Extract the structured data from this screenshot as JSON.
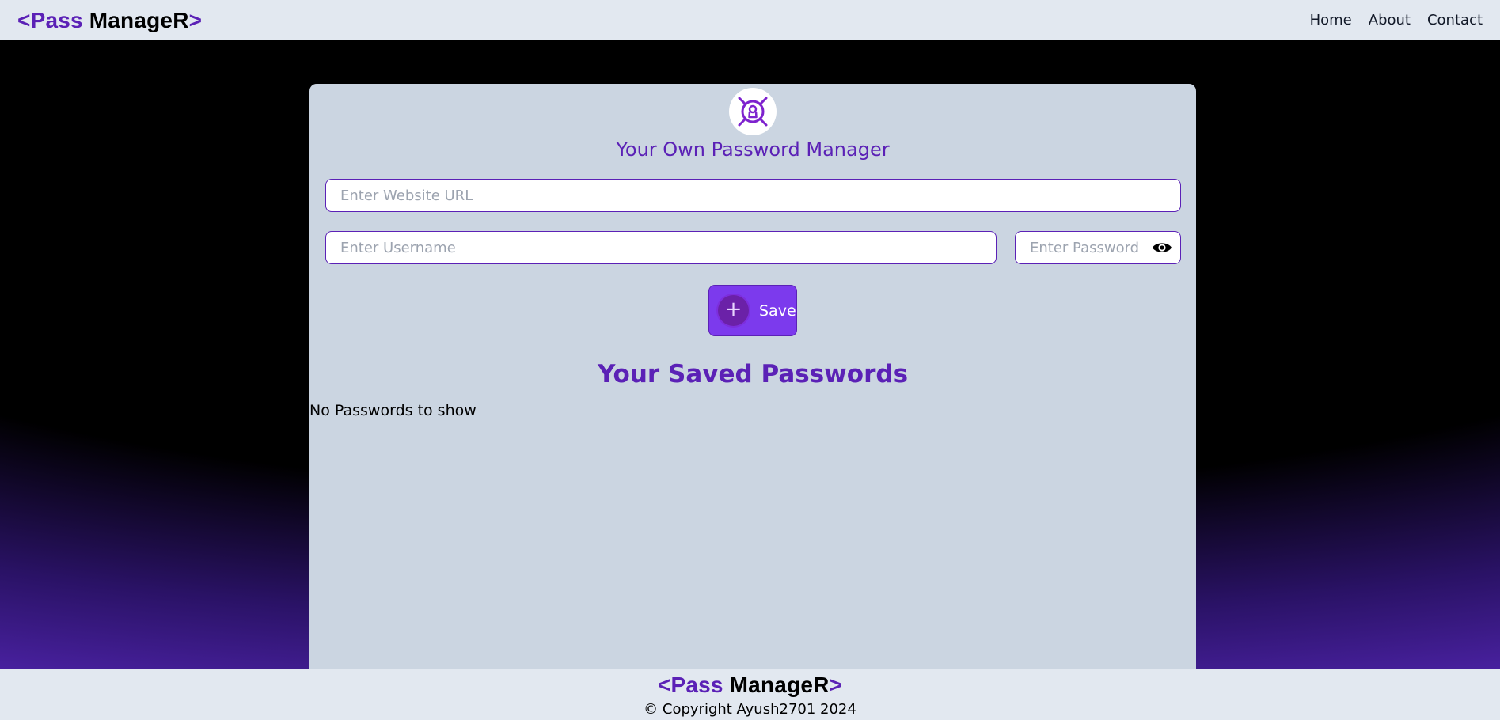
{
  "navbar": {
    "logo": {
      "open": "<",
      "first": "Pass",
      "second": " ManageR",
      "close": ">"
    },
    "links": [
      "Home",
      "About",
      "Contact"
    ]
  },
  "card": {
    "title": "Your Own Password Manager",
    "url_placeholder": "Enter Website URL",
    "username_placeholder": "Enter Username",
    "password_placeholder": "Enter Password",
    "save_label": "Save",
    "plus_icon": "+",
    "saved_title": "Your Saved Passwords",
    "empty_message": "No Passwords to show"
  },
  "footer": {
    "logo": {
      "open": "<",
      "first": "Pass",
      "second": " ManageR",
      "close": ">"
    },
    "copyright": "© Copyright Ayush2701 2024"
  },
  "colors": {
    "accent": "#5b21b6",
    "button": "#7c3aed",
    "card_bg": "#cbd5e1",
    "bar_bg": "#e2e8f0"
  },
  "icons": {
    "brand": "lock-target-icon",
    "reveal": "eye-icon",
    "add": "plus-icon"
  }
}
